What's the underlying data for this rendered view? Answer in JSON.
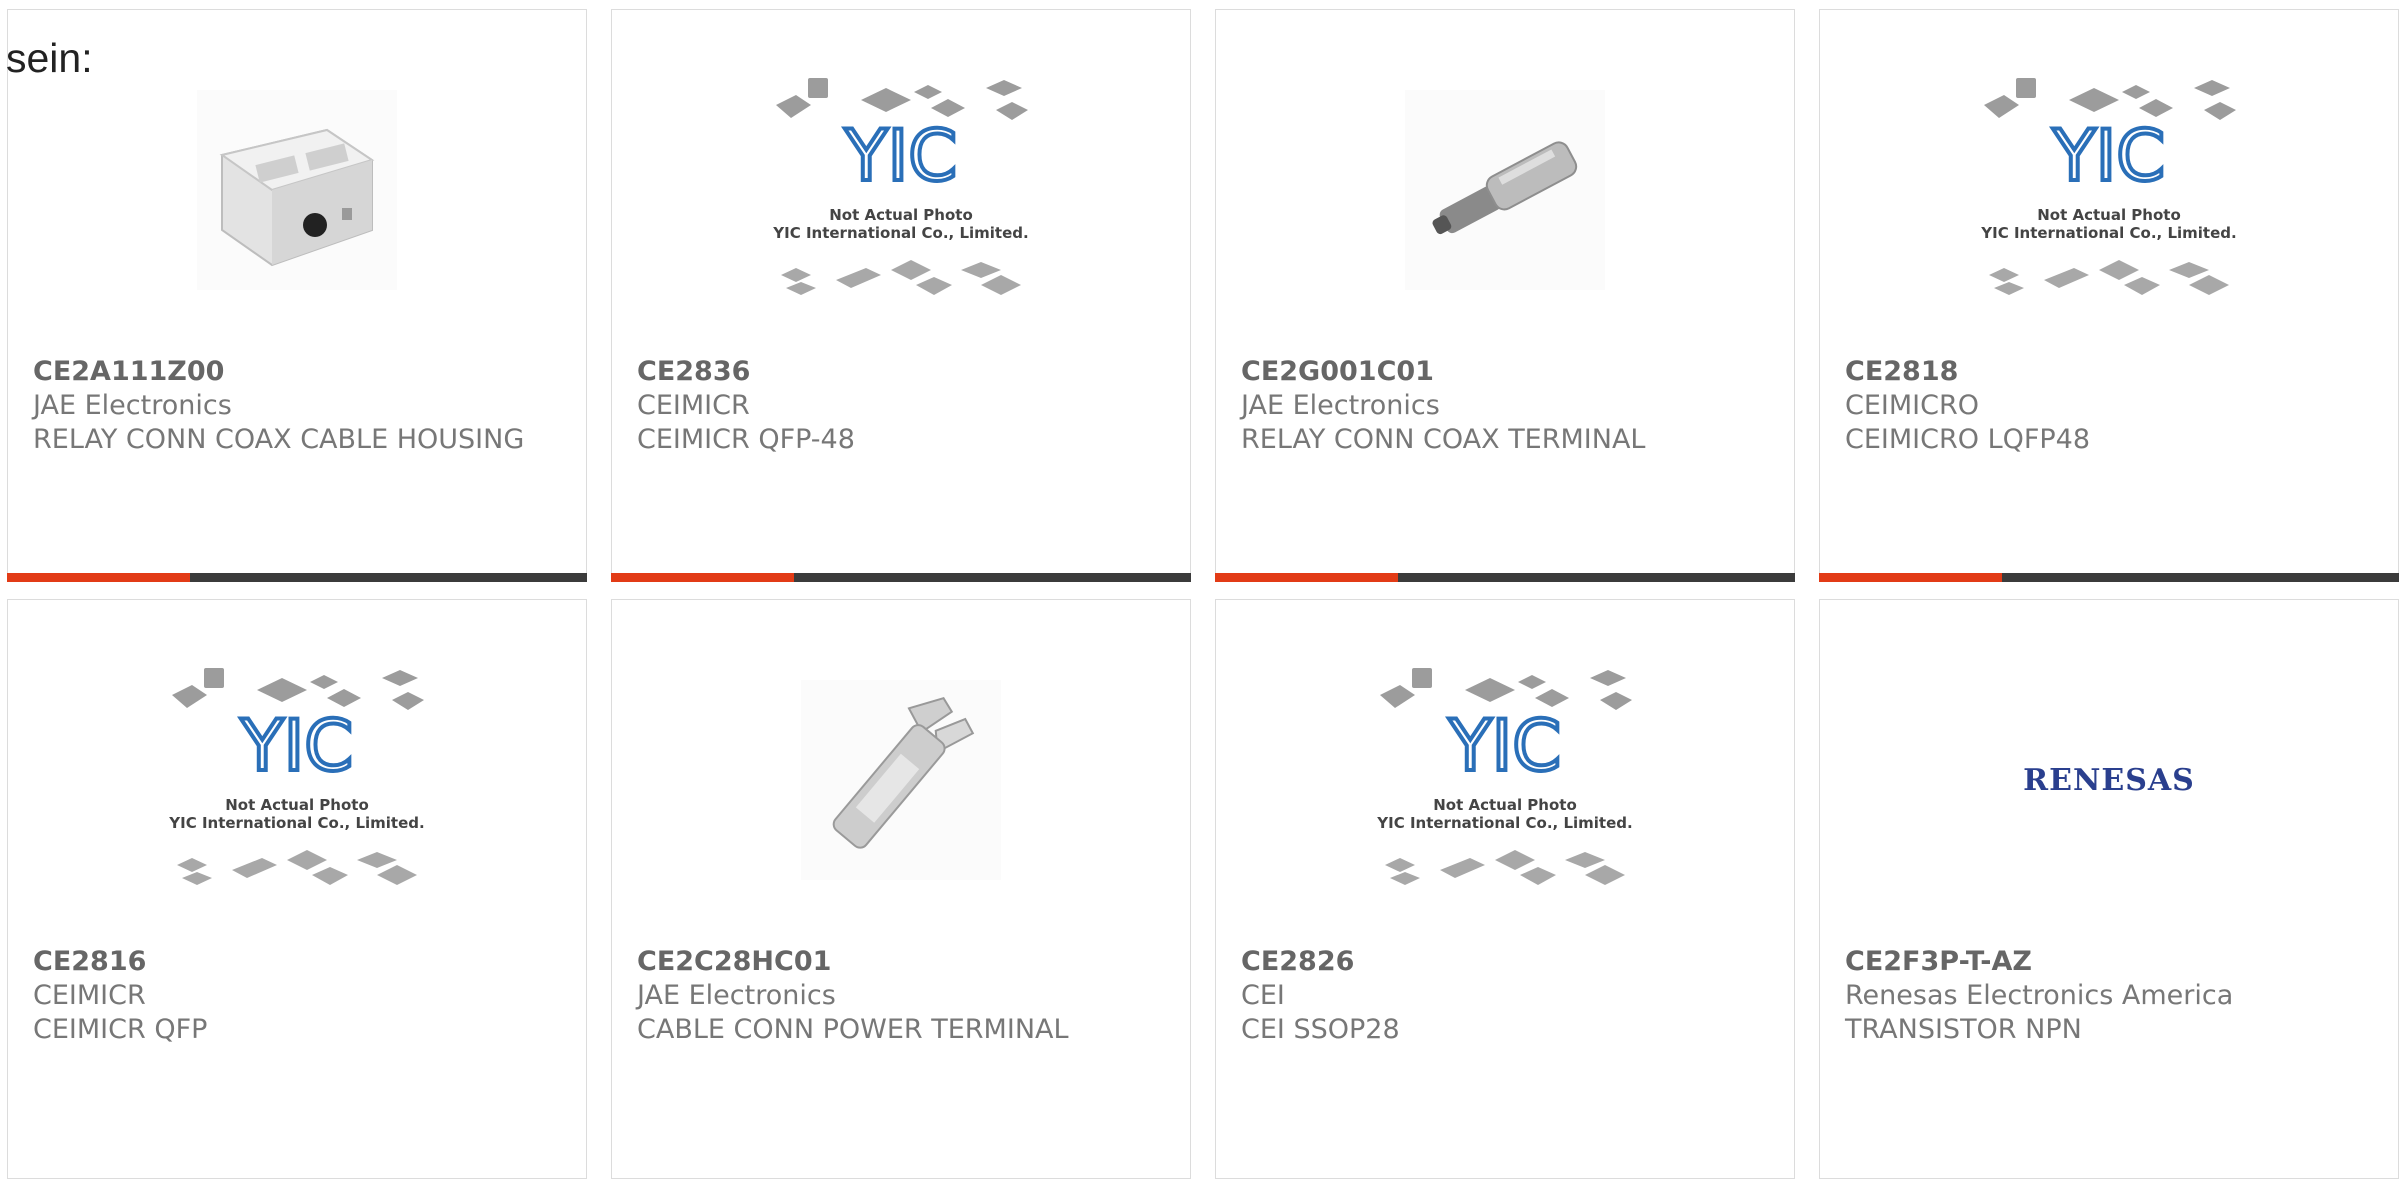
{
  "header": {
    "lead_text": "sein:"
  },
  "placeholder": {
    "line1": "Not Actual Photo",
    "line2": "YIC International Co., Limited.",
    "logo": "YIC"
  },
  "colors": {
    "accent": "#e23b16",
    "bar": "#3b3b3b",
    "text": "#777777"
  },
  "products": [
    {
      "part": "CE2A111Z00",
      "maker": "JAE Electronics",
      "desc": "RELAY CONN COAX CABLE HOUSING",
      "image": "connector-housing-photo"
    },
    {
      "part": "CE2836",
      "maker": "CEIMICR",
      "desc": "CEIMICR QFP-48",
      "image": "yic-placeholder"
    },
    {
      "part": "CE2G001C01",
      "maker": "JAE Electronics",
      "desc": "RELAY CONN COAX TERMINAL",
      "image": "coax-terminal-photo"
    },
    {
      "part": "CE2818",
      "maker": "CEIMICRO",
      "desc": "CEIMICRO LQFP48",
      "image": "yic-placeholder"
    },
    {
      "part": "CE2816",
      "maker": "CEIMICR",
      "desc": "CEIMICR QFP",
      "image": "yic-placeholder"
    },
    {
      "part": "CE2C28HC01",
      "maker": "JAE Electronics",
      "desc": "CABLE CONN POWER TERMINAL",
      "image": "power-terminal-photo"
    },
    {
      "part": "CE2826",
      "maker": "CEI",
      "desc": "CEI SSOP28",
      "image": "yic-placeholder"
    },
    {
      "part": "CE2F3P-T-AZ",
      "maker": "Renesas Electronics America",
      "desc": "TRANSISTOR NPN",
      "image": "renesas-logo",
      "logo_text": "RENESAS"
    }
  ]
}
